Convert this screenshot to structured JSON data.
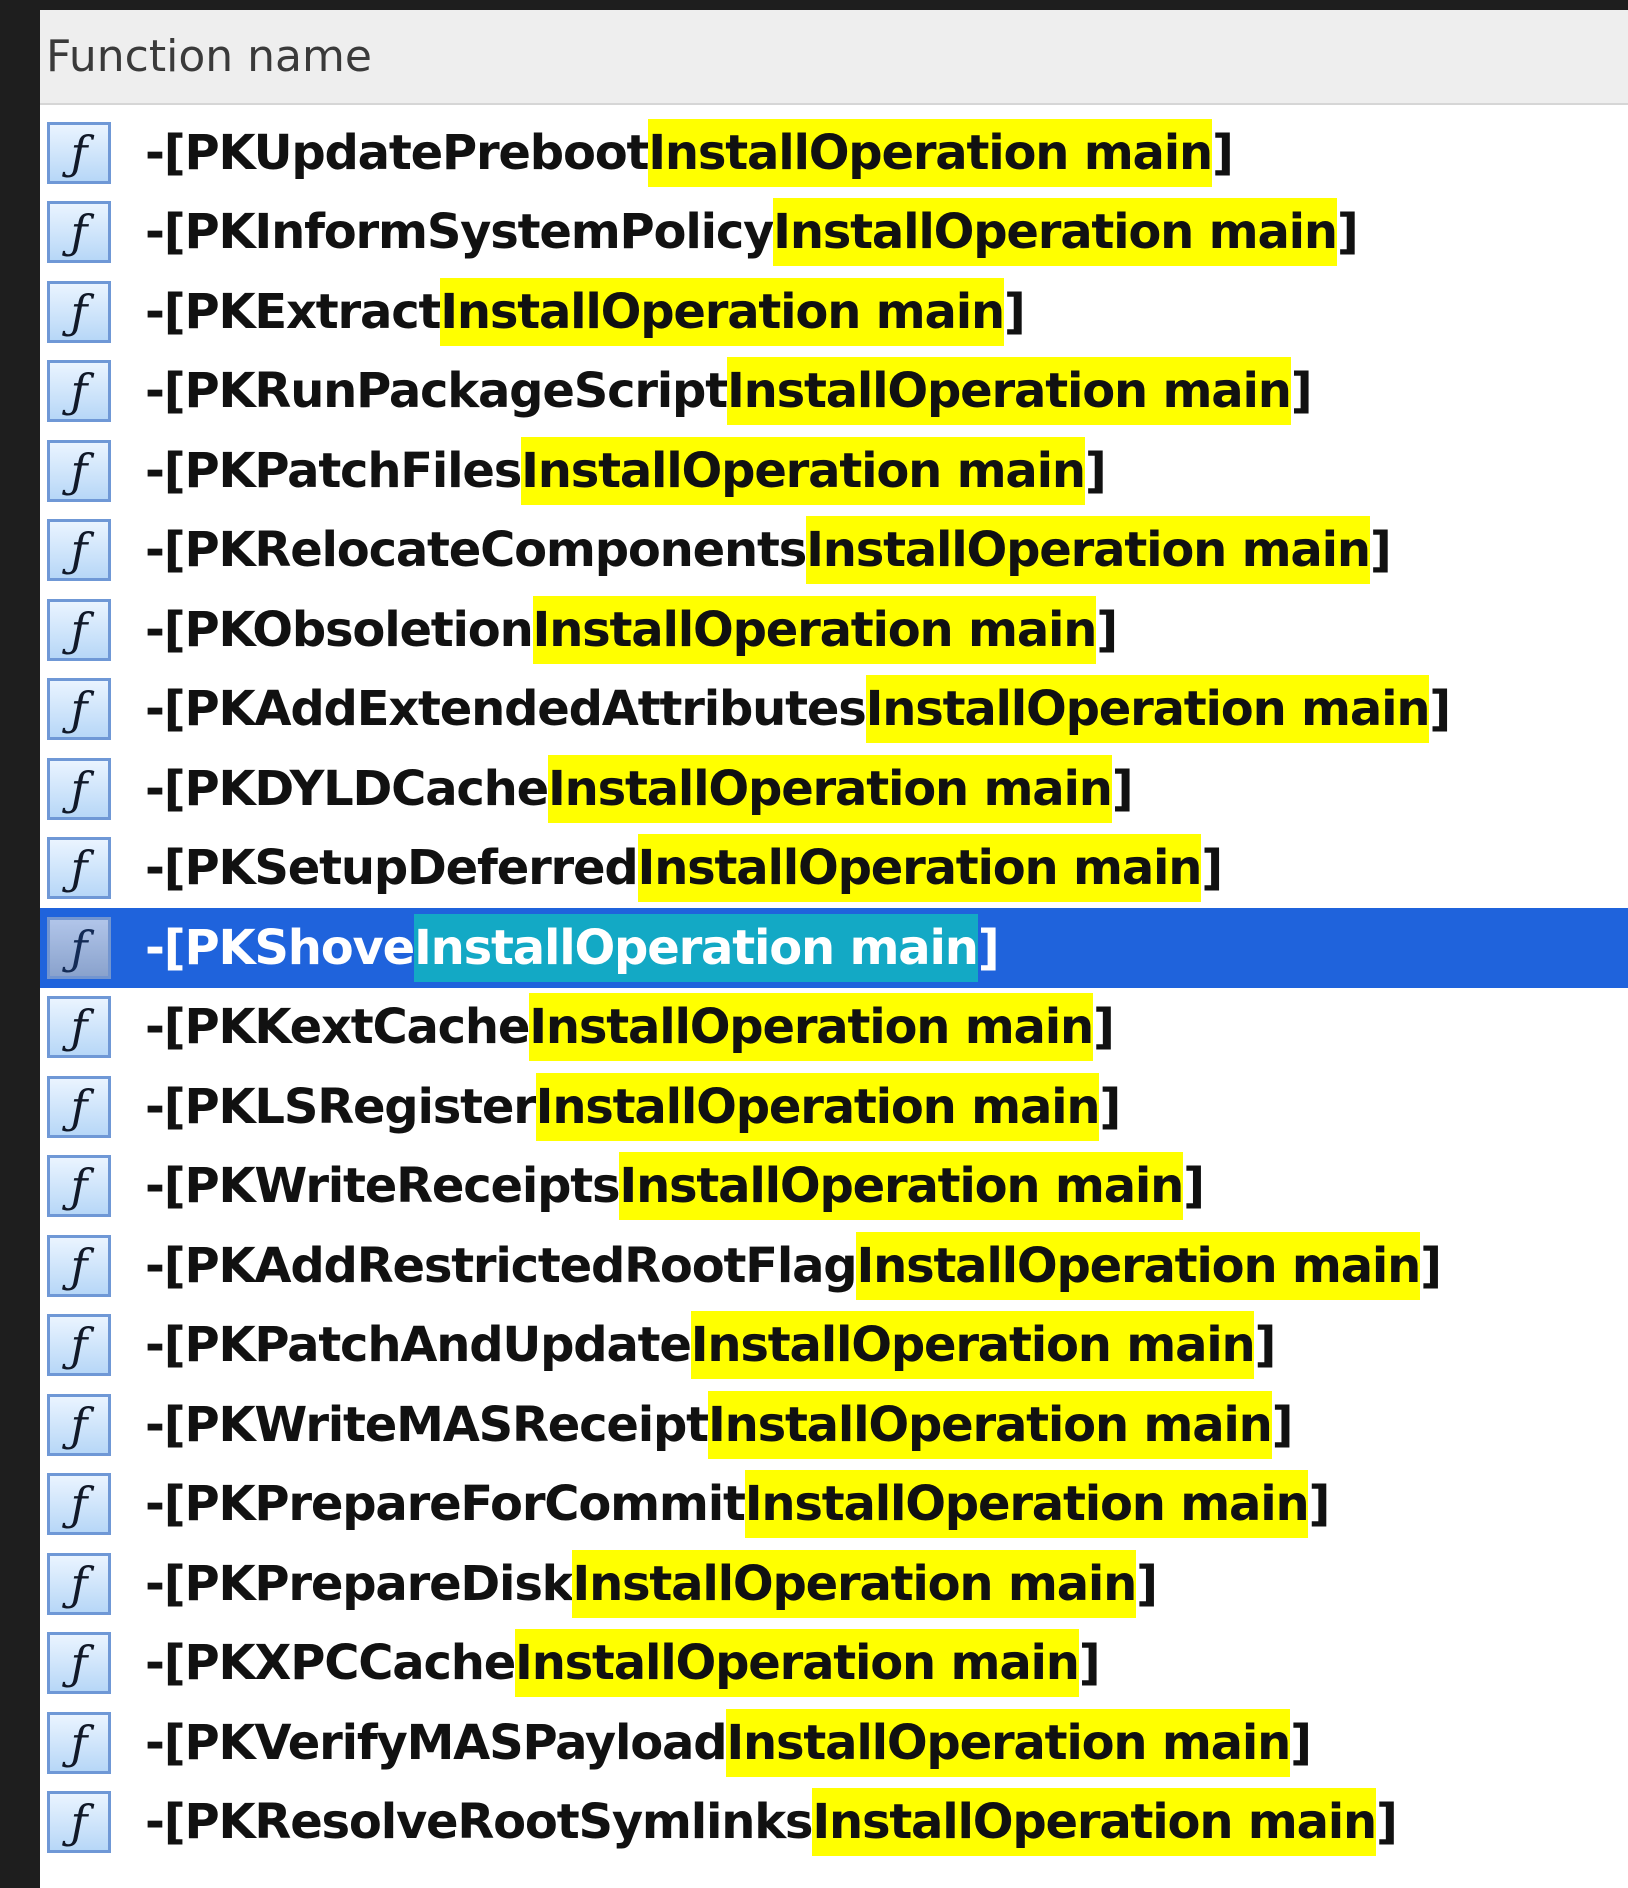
{
  "column_header": "Function name",
  "highlight_color": "#ffff00",
  "selected_highlight_color": "#13a9c5",
  "selection_color": "#1f63dc",
  "icon": "function-icon",
  "icon_glyph": "ƒ",
  "rows": [
    {
      "prefix": "-[PKUpdatePreboot",
      "match": "InstallOperation main",
      "suffix": "]",
      "selected": false
    },
    {
      "prefix": "-[PKInformSystemPolicy",
      "match": "InstallOperation main",
      "suffix": "]",
      "selected": false
    },
    {
      "prefix": "-[PKExtract",
      "match": "InstallOperation main",
      "suffix": "]",
      "selected": false
    },
    {
      "prefix": "-[PKRunPackageScript",
      "match": "InstallOperation main",
      "suffix": "]",
      "selected": false
    },
    {
      "prefix": "-[PKPatchFiles",
      "match": "InstallOperation main",
      "suffix": "]",
      "selected": false
    },
    {
      "prefix": "-[PKRelocateComponents",
      "match": "InstallOperation main",
      "suffix": "]",
      "selected": false
    },
    {
      "prefix": "-[PKObsoletion",
      "match": "InstallOperation main",
      "suffix": "]",
      "selected": false
    },
    {
      "prefix": "-[PKAddExtendedAttributes",
      "match": "InstallOperation main",
      "suffix": "]",
      "selected": false
    },
    {
      "prefix": "-[PKDYLDCache",
      "match": "InstallOperation main",
      "suffix": "]",
      "selected": false
    },
    {
      "prefix": "-[PKSetupDeferred",
      "match": "InstallOperation main",
      "suffix": "]",
      "selected": false
    },
    {
      "prefix": "-[PKShove",
      "match": "InstallOperation main",
      "suffix": "]",
      "selected": true
    },
    {
      "prefix": "-[PKKextCache",
      "match": "InstallOperation main",
      "suffix": "]",
      "selected": false
    },
    {
      "prefix": "-[PKLSRegister",
      "match": "InstallOperation main",
      "suffix": "]",
      "selected": false
    },
    {
      "prefix": "-[PKWriteReceipts",
      "match": "InstallOperation main",
      "suffix": "]",
      "selected": false
    },
    {
      "prefix": "-[PKAddRestrictedRootFlag",
      "match": "InstallOperation main",
      "suffix": "]",
      "selected": false
    },
    {
      "prefix": "-[PKPatchAndUpdate",
      "match": "InstallOperation main",
      "suffix": "]",
      "selected": false
    },
    {
      "prefix": "-[PKWriteMASReceipt",
      "match": "InstallOperation main",
      "suffix": "]",
      "selected": false
    },
    {
      "prefix": "-[PKPrepareForCommit",
      "match": "InstallOperation main",
      "suffix": "]",
      "selected": false
    },
    {
      "prefix": "-[PKPrepareDisk",
      "match": "InstallOperation main",
      "suffix": "]",
      "selected": false
    },
    {
      "prefix": "-[PKXPCCache",
      "match": "InstallOperation main",
      "suffix": "]",
      "selected": false
    },
    {
      "prefix": "-[PKVerifyMASPayload",
      "match": "InstallOperation main",
      "suffix": "]",
      "selected": false
    },
    {
      "prefix": "-[PKResolveRootSymlinks",
      "match": "InstallOperation main",
      "suffix": "]",
      "selected": false
    }
  ]
}
